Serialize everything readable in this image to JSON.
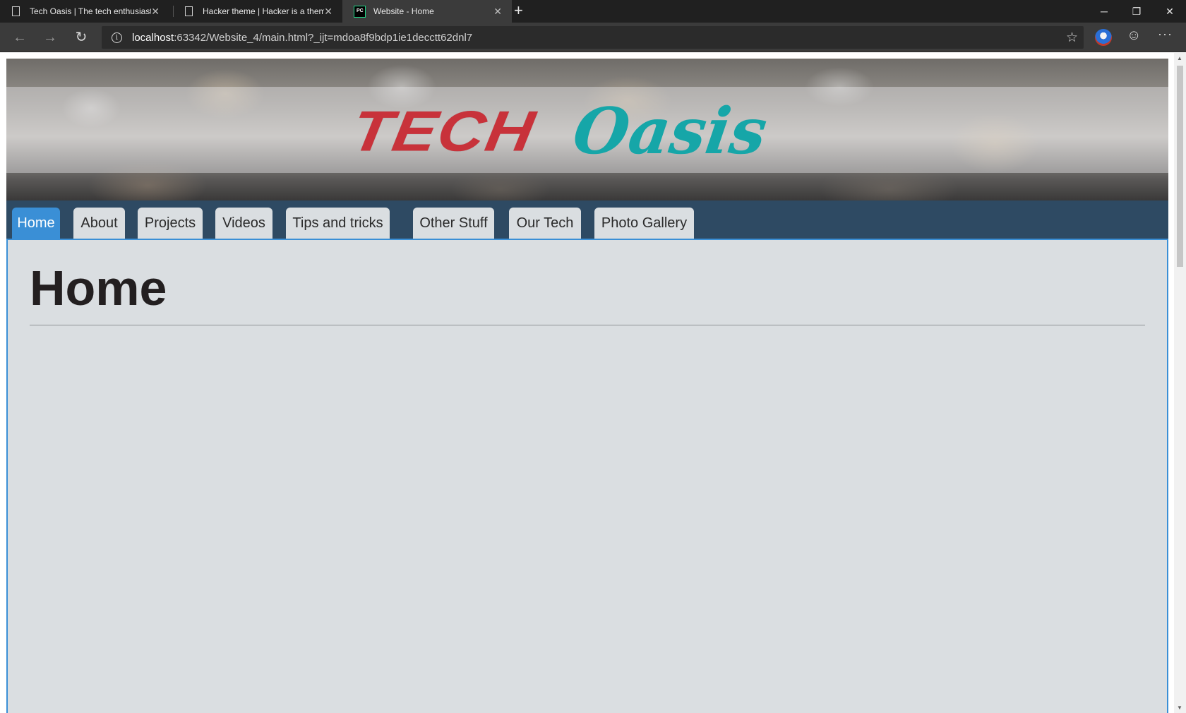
{
  "browser": {
    "tabs": [
      {
        "title": "Tech Oasis | The tech enthusiasts",
        "icon": "document-icon",
        "active": false
      },
      {
        "title": "Hacker theme | Hacker is a theme",
        "icon": "document-icon",
        "active": false
      },
      {
        "title": "Website - Home",
        "icon": "pycharm-icon",
        "active": true
      }
    ],
    "close_glyph": "✕",
    "new_tab_glyph": "+",
    "window_controls": {
      "minimize": "─",
      "restore": "❐",
      "close": "✕"
    },
    "nav": {
      "back": "←",
      "forward": "→",
      "reload": "↻"
    },
    "address": {
      "host": "localhost",
      "rest": ":63342/Website_4/main.html?_ijt=mdoa8f9bdp1ie1decctt62dnl7"
    },
    "info_glyph": "i",
    "favorite_glyph": "☆",
    "feedback_glyph": "☺",
    "more_glyph": "···",
    "scroll_up_glyph": "▲",
    "scroll_down_glyph": "▼"
  },
  "site": {
    "logo": {
      "part1": "TECH",
      "part2": "Oasis",
      "color1": "#c8323a",
      "color2": "#16a6a8"
    },
    "nav": {
      "items": [
        {
          "label": "Home",
          "active": true
        },
        {
          "label": "About",
          "active": false
        },
        {
          "label": "Projects",
          "active": false
        },
        {
          "label": "Videos",
          "active": false
        },
        {
          "label": "Tips and tricks",
          "active": false
        },
        {
          "label": "Other Stuff",
          "active": false
        },
        {
          "label": "Our Tech",
          "active": false
        },
        {
          "label": "Photo Gallery",
          "active": false
        }
      ],
      "bar_color": "#2e4a63",
      "active_color": "#3a8fd6"
    },
    "page_title": "Home"
  }
}
